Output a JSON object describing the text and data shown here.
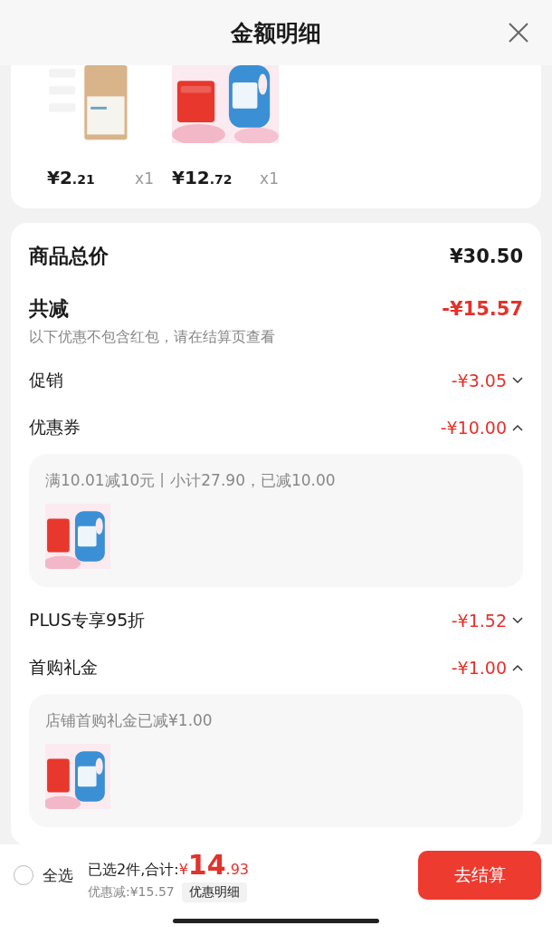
{
  "header": {
    "title": "金额明细"
  },
  "products": [
    {
      "kind": "bag",
      "price_int": "¥2",
      "price_dec": ".21",
      "qty": "x1"
    },
    {
      "kind": "bottle",
      "price_int": "¥12",
      "price_dec": ".72",
      "qty": "x1"
    }
  ],
  "summary": {
    "total_label": "商品总价",
    "total_value": "¥30.50",
    "reduce_label": "共减",
    "reduce_value": "-¥15.57",
    "note": "以下优惠不包含红包，请在结算页查看"
  },
  "discounts": [
    {
      "label": "促销",
      "value": "-¥3.05",
      "expanded": false
    },
    {
      "label": "优惠券",
      "value": "-¥10.00",
      "expanded": true,
      "detail": "满10.01减10元丨小计27.90，已减10.00"
    },
    {
      "label": "PLUS专享95折",
      "value": "-¥1.52",
      "expanded": false
    },
    {
      "label": "首购礼金",
      "value": "-¥1.00",
      "expanded": true,
      "detail": "店铺首购礼金已减¥1.00"
    }
  ],
  "footer": {
    "select_all": {
      "label": "全选",
      "checked": false
    },
    "selected_text": "已选2件,合计:",
    "total_symbol": "¥",
    "total_int": "14",
    "total_dec": ".93",
    "saving": "优惠减:¥15.57",
    "detail_button": "优惠明细",
    "checkout": "去结算"
  }
}
